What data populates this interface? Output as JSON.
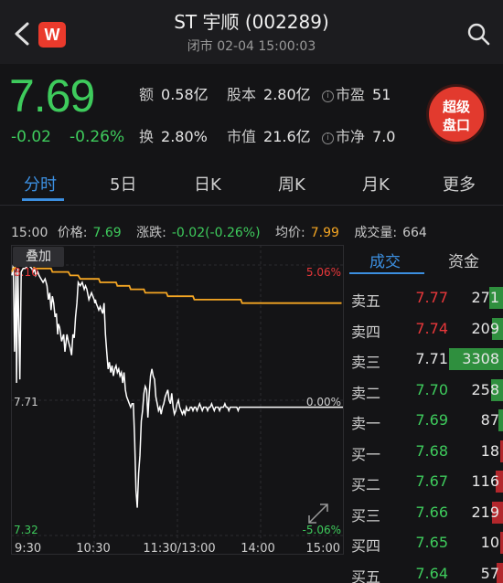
{
  "header": {
    "title": "ST 宇顺 (002289)",
    "subtitle": "闭市 02-04 15:00:03",
    "logo_letter": "W"
  },
  "quote": {
    "price": "7.69",
    "change": "-0.02",
    "change_pct": "-0.26%",
    "metrics": [
      {
        "label": "额",
        "value": "0.58亿"
      },
      {
        "label": "股本",
        "value": "2.80亿"
      },
      {
        "label": "市盈",
        "value": "51"
      },
      {
        "label": "换",
        "value": "2.80%"
      },
      {
        "label": "市值",
        "value": "21.6亿"
      },
      {
        "label": "市净",
        "value": "7.0"
      }
    ],
    "info_icon_glyph": "i",
    "super_button": [
      "超级",
      "盘口"
    ]
  },
  "tabs": [
    "分时",
    "5日",
    "日K",
    "周K",
    "月K",
    "更多"
  ],
  "status": {
    "time": "15:00",
    "price_label": "价格:",
    "price": "7.69",
    "change_label": "涨跌:",
    "change": "-0.02(-0.26%)",
    "avg_label": "均价:",
    "avg": "7.99",
    "volume_label": "成交量:",
    "volume": "664"
  },
  "chart_data": {
    "type": "line",
    "overlay_label": "叠加",
    "y_labels_left": [
      "8.10",
      "7.71",
      "7.32"
    ],
    "y_labels_right": [
      "5.06%",
      "0.00%",
      "-5.06%"
    ],
    "x_labels": [
      "9:30",
      "10:30",
      "11:30/13:00",
      "14:00",
      "15:00"
    ],
    "ylim": [
      7.32,
      8.1
    ],
    "x": [
      0,
      4,
      8,
      12,
      14,
      18,
      24,
      28,
      34,
      40,
      50,
      60,
      64,
      68,
      72,
      78,
      82,
      88,
      94,
      100,
      106,
      110,
      114,
      118,
      122,
      126,
      130,
      134,
      138,
      140,
      144,
      150,
      156,
      160,
      166,
      170,
      176,
      180,
      184,
      188,
      192,
      196,
      200,
      206,
      212,
      218,
      222,
      226,
      228,
      232,
      236,
      240,
      244,
      248,
      250,
      252,
      254,
      258,
      262,
      266,
      270,
      274,
      278,
      282,
      286,
      290,
      294,
      298,
      302,
      306,
      310,
      314,
      318,
      322,
      326,
      330,
      334,
      338,
      342,
      346,
      350,
      354,
      358,
      362,
      366,
      370,
      374,
      378,
      382,
      386,
      390,
      394,
      398,
      402,
      406,
      410,
      414,
      418,
      422,
      426,
      430,
      434,
      438,
      442,
      446,
      450,
      454,
      458,
      462,
      466,
      470,
      474,
      478,
      482,
      486,
      490,
      494,
      498,
      502,
      506,
      510,
      514,
      518,
      522,
      526,
      530,
      534,
      538,
      542,
      546,
      550,
      554,
      558,
      562,
      566,
      570,
      574,
      578,
      582,
      586,
      590,
      594,
      598,
      602,
      606,
      610,
      614,
      618,
      622,
      626,
      630,
      634,
      638,
      642,
      646,
      650,
      654,
      658,
      662,
      666,
      670,
      674,
      678,
      682,
      686,
      690,
      694,
      698,
      702,
      706,
      710,
      714,
      718,
      722,
      726,
      730,
      734,
      738,
      742,
      746,
      750,
      754,
      758,
      762,
      766,
      770,
      774,
      778,
      782,
      786,
      790,
      794,
      798,
      802,
      806,
      810,
      814,
      818,
      822,
      826,
      830,
      834,
      838,
      842,
      846,
      850,
      854,
      858,
      862,
      866,
      870,
      874,
      878,
      882,
      886,
      890,
      894,
      898,
      902,
      906,
      910,
      914,
      918,
      922,
      926,
      930,
      934,
      938,
      942,
      946,
      950,
      954,
      958,
      962,
      966,
      970,
      974,
      978,
      982,
      986,
      990,
      994,
      998
    ],
    "series": [
      {
        "values": [
          8.07,
          8.1,
          7.85,
          8.08,
          7.76,
          8.09,
          7.77,
          8.08,
          8.09,
          8.09,
          8.1,
          8.09,
          8.08,
          8.09,
          8.07,
          8.08,
          8.07,
          8.06,
          8.05,
          8.06,
          8.04,
          8.0,
          8.02,
          7.97,
          8.01,
          7.99,
          7.95,
          7.96,
          7.9,
          7.93,
          7.92,
          7.88,
          7.9,
          7.85,
          7.9,
          7.88,
          7.86,
          7.84,
          7.9,
          7.89,
          7.95,
          7.99,
          8.05,
          8.04,
          8.05,
          8.03,
          8.04,
          8.03,
          8.02,
          8.0,
          8.01,
          8.02,
          8.01,
          8.0,
          7.99,
          8.0,
          7.99,
          7.98,
          7.97,
          7.98,
          7.97,
          7.96,
          7.99,
          7.9,
          7.85,
          7.8,
          7.82,
          7.79,
          7.81,
          7.78,
          7.8,
          7.81,
          7.79,
          7.8,
          7.78,
          7.79,
          7.76,
          7.79,
          7.74,
          7.72,
          7.71,
          7.7,
          7.69,
          7.7,
          7.7,
          7.6,
          7.45,
          7.4,
          7.5,
          7.55,
          7.65,
          7.68,
          7.73,
          7.75,
          7.74,
          7.66,
          7.73,
          7.78,
          7.8,
          7.78,
          7.77,
          7.72,
          7.7,
          7.68,
          7.69,
          7.67,
          7.69,
          7.7,
          7.72,
          7.73,
          7.74,
          7.71,
          7.7,
          7.73,
          7.69,
          7.67,
          7.68,
          7.7,
          7.71,
          7.69,
          7.68,
          7.67,
          7.68,
          7.67,
          7.69,
          7.68,
          7.68,
          7.69,
          7.69,
          7.68,
          7.69,
          7.69,
          7.68,
          7.69,
          7.7,
          7.69,
          7.68,
          7.69,
          7.69,
          7.69,
          7.68,
          7.69,
          7.69,
          7.7,
          7.69,
          7.68,
          7.69,
          7.69,
          7.69,
          7.68,
          7.69,
          7.69,
          7.69,
          7.7,
          7.69,
          7.69,
          7.68,
          7.69,
          7.69,
          7.69,
          7.69,
          7.69,
          7.69,
          7.68,
          7.69,
          7.69,
          7.69,
          7.69,
          7.69,
          7.69,
          7.69,
          7.69,
          7.69,
          7.69,
          7.69,
          7.69,
          7.69,
          7.69,
          7.69,
          7.69,
          7.69,
          7.69,
          7.69,
          7.69,
          7.69,
          7.69,
          7.69,
          7.69,
          7.69,
          7.69,
          7.69,
          7.69,
          7.69,
          7.69,
          7.69,
          7.69,
          7.69,
          7.69,
          7.69,
          7.69,
          7.69,
          7.69,
          7.69,
          7.69,
          7.69,
          7.69,
          7.69,
          7.69,
          7.69,
          7.69,
          7.69,
          7.69,
          7.69,
          7.69,
          7.69,
          7.69,
          7.69,
          7.69,
          7.69,
          7.69,
          7.69,
          7.69,
          7.69,
          7.69,
          7.69,
          7.69,
          7.69,
          7.69,
          7.69,
          7.69,
          7.69,
          7.69,
          7.69,
          7.69,
          7.69,
          7.69,
          7.69,
          7.69,
          7.69,
          7.69,
          7.69,
          7.69,
          7.69
        ],
        "color": "#ffffff"
      },
      {
        "values": [
          8.08,
          8.09,
          8.09,
          8.1,
          8.1,
          8.1,
          8.1,
          8.1,
          8.1,
          8.1,
          8.1,
          8.1,
          8.1,
          8.09,
          8.09,
          8.09,
          8.09,
          8.09,
          8.09,
          8.09,
          8.09,
          8.09,
          8.09,
          8.09,
          8.08,
          8.08,
          8.08,
          8.08,
          8.08,
          8.08,
          8.08,
          8.08,
          8.08,
          8.08,
          8.08,
          8.08,
          8.07,
          8.07,
          8.07,
          8.07,
          8.07,
          8.07,
          8.07,
          8.06,
          8.06,
          8.06,
          8.06,
          8.06,
          8.06,
          8.06,
          8.06,
          8.06,
          8.06,
          8.06,
          8.06,
          8.06,
          8.06,
          8.06,
          8.06,
          8.05,
          8.05,
          8.05,
          8.05,
          8.05,
          8.05,
          8.05,
          8.05,
          8.05,
          8.05,
          8.05,
          8.05,
          8.05,
          8.04,
          8.04,
          8.04,
          8.04,
          8.04,
          8.04,
          8.04,
          8.04,
          8.04,
          8.04,
          8.03,
          8.03,
          8.03,
          8.03,
          8.03,
          8.03,
          8.03,
          8.03,
          8.03,
          8.03,
          8.03,
          8.02,
          8.02,
          8.02,
          8.02,
          8.02,
          8.02,
          8.02,
          8.02,
          8.02,
          8.02,
          8.02,
          8.02,
          8.02,
          8.02,
          8.02,
          8.02,
          8.02,
          8.01,
          8.01,
          8.01,
          8.01,
          8.01,
          8.01,
          8.01,
          8.01,
          8.01,
          8.01,
          8.01,
          8.01,
          8.01,
          8.01,
          8.01,
          8.01,
          8.01,
          8.01,
          8.01,
          8.01,
          8.0,
          8.0,
          8.0,
          8.0,
          8.0,
          8.0,
          8.0,
          8.0,
          8.0,
          8.0,
          8.0,
          8.0,
          8.0,
          8.0,
          8.0,
          8.0,
          8.0,
          8.0,
          8.0,
          8.0,
          8.0,
          8.0,
          8.0,
          8.0,
          8.0,
          8.0,
          8.0,
          8.0,
          8.0,
          8.0,
          8.0,
          8.0,
          8.0,
          8.0,
          8.0,
          8.0,
          7.99,
          7.99,
          7.99,
          7.99,
          7.99,
          7.99,
          7.99,
          7.99,
          7.99,
          7.99,
          7.99,
          7.99,
          7.99,
          7.99,
          7.99,
          7.99,
          7.99,
          7.99,
          7.99,
          7.99,
          7.99,
          7.99,
          7.99,
          7.99,
          7.99,
          7.99,
          7.99,
          7.99,
          7.99,
          7.99,
          7.99,
          7.99,
          7.99,
          7.99,
          7.99,
          7.99,
          7.99,
          7.99,
          7.99,
          7.99,
          7.99,
          7.99,
          7.99,
          7.99,
          7.99,
          7.99,
          7.99,
          7.99,
          7.99,
          7.99,
          7.99,
          7.99,
          7.99,
          7.99,
          7.99,
          7.99,
          7.99,
          7.99,
          7.99,
          7.99,
          7.99,
          7.99,
          7.99,
          7.99,
          7.99,
          7.99,
          7.99,
          7.99,
          7.99,
          7.99,
          7.99,
          7.99,
          7.99,
          7.99,
          7.99,
          7.99
        ],
        "color": "#f5a623"
      }
    ]
  },
  "order_book": {
    "tabs": [
      "成交",
      "资金"
    ],
    "rows": [
      {
        "label": "卖五",
        "price": "7.77",
        "price_color": "#e8373a",
        "volume": "271",
        "bar": "#2f8f3e",
        "bar_frac": 0.09
      },
      {
        "label": "卖四",
        "price": "7.74",
        "price_color": "#e8373a",
        "volume": "209",
        "bar": "#2f8f3e",
        "bar_frac": 0.07
      },
      {
        "label": "卖三",
        "price": "7.71",
        "price_color": "#e6e6e6",
        "volume": "3308",
        "bar": "#2f8f3e",
        "bar_frac": 0.35
      },
      {
        "label": "卖二",
        "price": "7.70",
        "price_color": "#3ecb5c",
        "volume": "258",
        "bar": "#2f8f3e",
        "bar_frac": 0.08
      },
      {
        "label": "卖一",
        "price": "7.69",
        "price_color": "#3ecb5c",
        "volume": "87",
        "bar": "#2f8f3e",
        "bar_frac": 0.03
      },
      {
        "label": "买一",
        "price": "7.68",
        "price_color": "#3ecb5c",
        "volume": "18",
        "bar": "#b3272c",
        "bar_frac": 0.02
      },
      {
        "label": "买二",
        "price": "7.67",
        "price_color": "#3ecb5c",
        "volume": "116",
        "bar": "#b3272c",
        "bar_frac": 0.05
      },
      {
        "label": "买三",
        "price": "7.66",
        "price_color": "#3ecb5c",
        "volume": "219",
        "bar": "#b3272c",
        "bar_frac": 0.07
      },
      {
        "label": "买四",
        "price": "7.65",
        "price_color": "#3ecb5c",
        "volume": "10",
        "bar": "#b3272c",
        "bar_frac": 0.02
      },
      {
        "label": "买五",
        "price": "7.64",
        "price_color": "#3ecb5c",
        "volume": "57",
        "bar": "#b3272c",
        "bar_frac": 0.04
      }
    ]
  }
}
